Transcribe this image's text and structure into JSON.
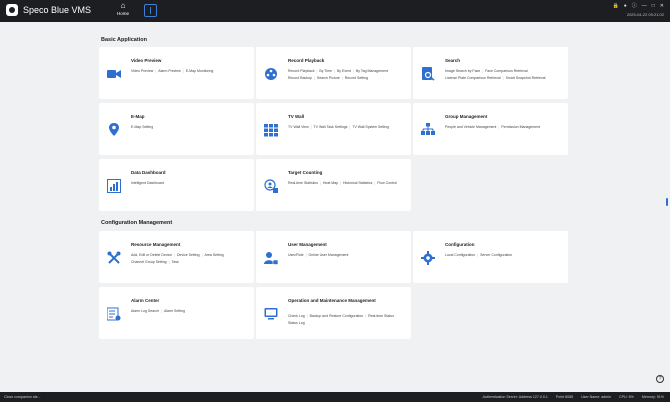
{
  "app": {
    "name": "Speco Blue VMS",
    "home_label": "Home",
    "datetime": "2025-04-22 09:21:02"
  },
  "colors": {
    "accent": "#2f6fcf",
    "topbar": "#1c1e22",
    "background": "#f0f1f3"
  },
  "sections": {
    "basic": {
      "title": "Basic Application"
    },
    "config": {
      "title": "Configuration Management"
    }
  },
  "cards": {
    "video_preview": {
      "title": "Video Preview",
      "icon": "video-camera-icon",
      "links": [
        "Video Preview",
        "Alarm Preview",
        "E-Map Monitoring"
      ]
    },
    "record_playback": {
      "title": "Record  Playback",
      "icon": "film-reel-icon",
      "links": [
        "Record Playback",
        "By Time",
        "By Event",
        "By Tag Management",
        "Record Backup",
        "Search Picture",
        "Record Setting"
      ]
    },
    "search": {
      "title": "Search",
      "icon": "search-document-icon",
      "links": [
        "Image Search by Face",
        "Face Comparison Retrieval",
        "License Plate Comparison Retrieval",
        "Smart Snapshot Retrieval"
      ]
    },
    "emap": {
      "title": "E-Map",
      "icon": "map-pin-icon",
      "links": [
        "E-Map Setting"
      ]
    },
    "tv_wall": {
      "title": "TV Wall",
      "icon": "video-wall-icon",
      "links": [
        "TV Wall View",
        "TV Wall Task Settings",
        "TV Wall System Setting"
      ]
    },
    "group_management": {
      "title": "Group Management",
      "icon": "org-chart-icon",
      "links": [
        "People and Vehicle Management",
        "Permission Management"
      ]
    },
    "data_dashboard": {
      "title": "Data Dashboard",
      "icon": "dashboard-chart-icon",
      "links": [
        "Intelligent Dashboard"
      ]
    },
    "target_counting": {
      "title": "Target Counting",
      "icon": "counting-icon",
      "links": [
        "Real-time Statistics",
        "Heat Map",
        "Historical Statistics",
        "Flow Control"
      ]
    },
    "resource_management": {
      "title": "Resource Management",
      "icon": "tools-icon",
      "links": [
        "Add, Edit or Delete Device",
        "Device Setting",
        "Area Setting",
        "Channel Group Setting",
        "Task"
      ]
    },
    "user_management": {
      "title": "User Management",
      "icon": "user-lock-icon",
      "links": [
        "User/Role",
        "Online User Management"
      ]
    },
    "configuration": {
      "title": "Configuration",
      "icon": "gear-icon",
      "links": [
        "Local Configuration",
        "Server Configuration"
      ]
    },
    "alarm_center": {
      "title": "Alarm Center",
      "icon": "alarm-list-icon",
      "links": [
        "Alarm Log Search",
        "Alarm Setting"
      ]
    },
    "operation_maintenance": {
      "title": "Operation and Maintenance Management",
      "icon": "monitor-icon",
      "links": [
        "Check Log",
        "Backup and Restore Configuration",
        "Real-time Status",
        "Status Log"
      ]
    }
  },
  "statusbar": {
    "left": "Close companion ale...",
    "auth": "Authentication Server: Address 127.0.0.1",
    "port": "Point 8085",
    "user": "User Name: admin",
    "cpu": "CPU: 6%",
    "memory": "Memory: 91%"
  }
}
